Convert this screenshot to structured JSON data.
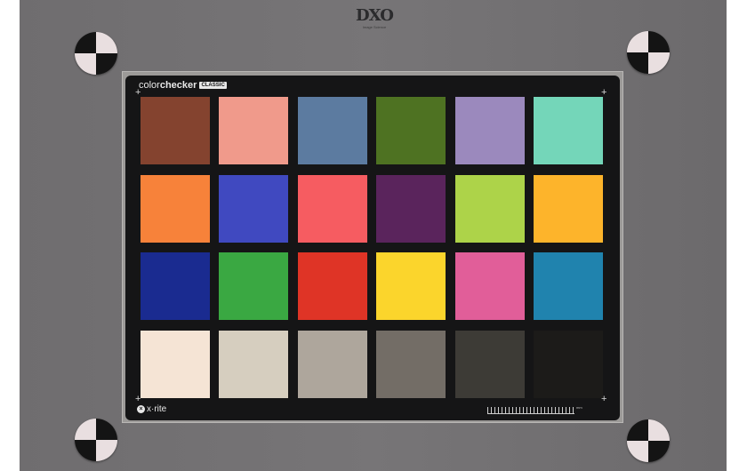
{
  "logo": {
    "main": "DXO",
    "sub": "Image Science"
  },
  "chart": {
    "brand_light": "color",
    "brand_bold": "checker",
    "brand_badge": "CLASSIC",
    "footer_brand": "x·rite",
    "ruler_end": "mm"
  },
  "colors": {
    "backdrop": "#737173",
    "card": "#151516",
    "patches": [
      "#84432f",
      "#f09a8b",
      "#5c7ba0",
      "#4e7222",
      "#9b89bd",
      "#74d6b9",
      "#f7823a",
      "#4049c0",
      "#f65c61",
      "#5a245c",
      "#add349",
      "#fdb42b",
      "#1a2b90",
      "#3aa842",
      "#df3426",
      "#fbd52c",
      "#e15e99",
      "#2083ae",
      "#f5e4d5",
      "#d6cebf",
      "#aea69c",
      "#736d66",
      "#3d3b36",
      "#1c1b19"
    ]
  }
}
